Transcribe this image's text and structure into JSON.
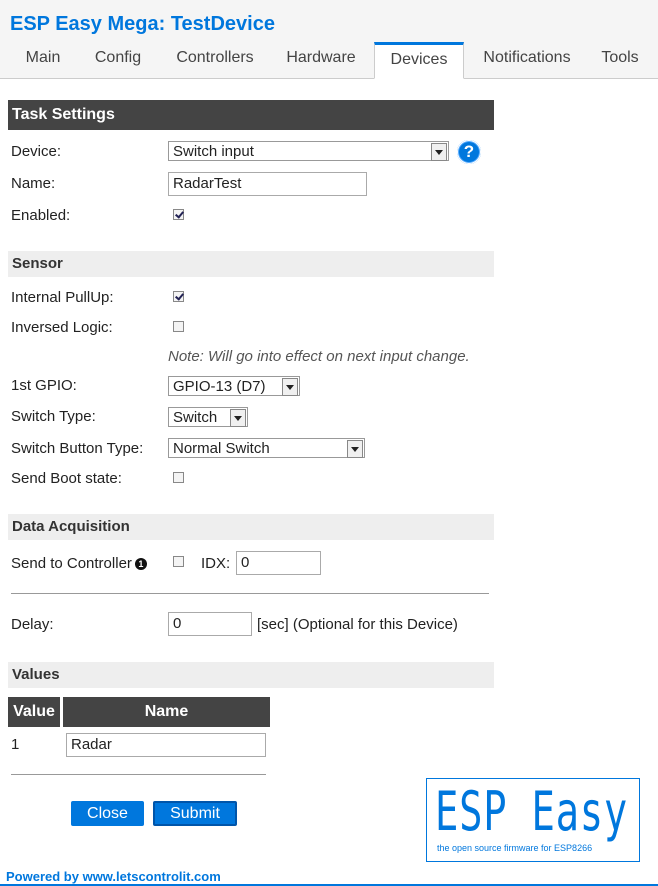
{
  "app": {
    "title": "ESP Easy Mega: TestDevice"
  },
  "tabs": [
    {
      "label": "Main"
    },
    {
      "label": "Config"
    },
    {
      "label": "Controllers"
    },
    {
      "label": "Hardware"
    },
    {
      "label": "Devices",
      "active": true
    },
    {
      "label": "Notifications"
    },
    {
      "label": "Tools"
    }
  ],
  "task_settings": {
    "header": "Task Settings",
    "device_label": "Device:",
    "device_value": "Switch input",
    "help_icon": "question-icon",
    "help_glyph": "?",
    "name_label": "Name:",
    "name_value": "RadarTest",
    "enabled_label": "Enabled:",
    "enabled": true
  },
  "sensor": {
    "header": "Sensor",
    "pullup_label": "Internal PullUp:",
    "pullup": true,
    "inversed_label": "Inversed Logic:",
    "inversed": false,
    "note": "Note: Will go into effect on next input change.",
    "gpio_label": "1st GPIO:",
    "gpio_value": "GPIO-13 (D7)",
    "switch_type_label": "Switch Type:",
    "switch_type_value": "Switch",
    "button_type_label": "Switch Button Type:",
    "button_type_value": "Normal Switch",
    "boot_state_label": "Send Boot state:",
    "boot_state": false
  },
  "data_acquisition": {
    "header": "Data Acquisition",
    "send_label": "Send to Controller",
    "info_glyph": "1",
    "send": false,
    "idx_label": "IDX:",
    "idx_value": "0",
    "delay_label": "Delay:",
    "delay_value": "0",
    "delay_suffix": "[sec] (Optional for this Device)"
  },
  "values": {
    "header": "Values",
    "col_value": "Value",
    "col_name": "Name",
    "rows": [
      {
        "value": "1",
        "name": "Radar"
      }
    ]
  },
  "buttons": {
    "close": "Close",
    "submit": "Submit"
  },
  "footer": {
    "powered_by": "Powered by www.letscontrolit.com"
  },
  "logo": {
    "main": "ESP Easy",
    "sub": "the open source firmware for ESP8266"
  },
  "colors": {
    "accent": "#0077dd",
    "section_dark": "#444444",
    "section_light": "#eeeeee"
  }
}
